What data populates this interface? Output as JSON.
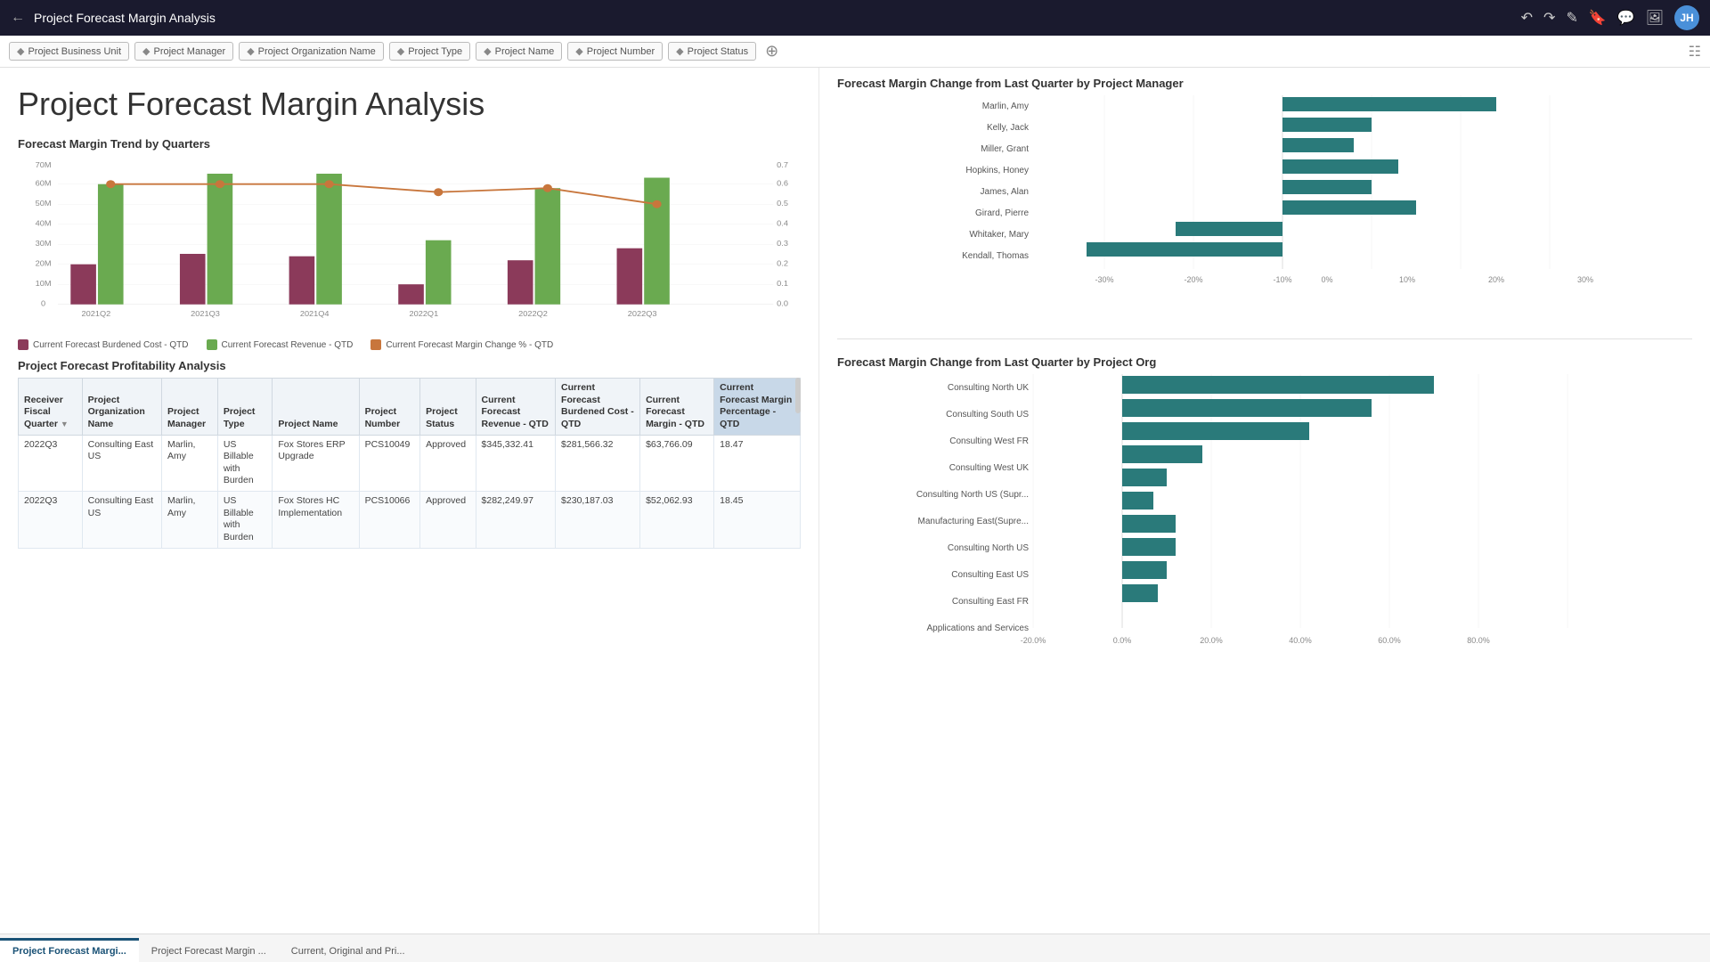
{
  "titleBar": {
    "title": "Project Forecast Margin Analysis",
    "avatar": "JH"
  },
  "filterBar": {
    "chips": [
      "Project Business Unit",
      "Project Manager",
      "Project Organization Name",
      "Project Type",
      "Project Name",
      "Project Number",
      "Project Status"
    ]
  },
  "pageTitle": "Project Forecast Margin Analysis",
  "forecastTrendChart": {
    "title": "Forecast Margin Trend by Quarters",
    "quarters": [
      "2021Q2",
      "2021Q3",
      "2021Q4",
      "2022Q1",
      "2022Q2",
      "2022Q3"
    ],
    "legend": [
      {
        "label": "Current Forecast Burdened Cost - QTD",
        "color": "#8b3a5a"
      },
      {
        "label": "Current Forecast Revenue - QTD",
        "color": "#6aaa50"
      },
      {
        "label": "Current Forecast Margin Change % - QTD",
        "color": "#c8763c"
      }
    ],
    "yAxisLeft": [
      "0",
      "10M",
      "20M",
      "30M",
      "40M",
      "50M",
      "60M",
      "70M"
    ],
    "yAxisRight": [
      "0.0",
      "0.1",
      "0.2",
      "0.3",
      "0.4",
      "0.5",
      "0.6",
      "0.7"
    ]
  },
  "profitabilityTable": {
    "title": "Project Forecast Profitability Analysis",
    "headers": [
      "Receiver Fiscal Quarter",
      "Project Organization Name",
      "Project Manager",
      "Project Type",
      "Project Name",
      "Project Number",
      "Project Status",
      "Current Forecast Revenue - QTD",
      "Current Forecast Burdened Cost - QTD",
      "Current Forecast Margin - QTD",
      "Current Forecast Margin Percentage - QTD"
    ],
    "rows": [
      {
        "quarter": "2022Q3",
        "orgName": "Consulting East US",
        "manager": "Marlin, Amy",
        "type": "US Billable with Burden",
        "projectName": "Fox Stores ERP Upgrade",
        "number": "PCS10049",
        "status": "Approved",
        "revenue": "$345,332.41",
        "cost": "$281,566.32",
        "margin": "$63,766.09",
        "marginPct": "18.47"
      },
      {
        "quarter": "2022Q3",
        "orgName": "Consulting East US",
        "manager": "Marlin, Amy",
        "type": "US Billable with Burden",
        "projectName": "Fox Stores HC Implementation",
        "number": "PCS10066",
        "status": "Approved",
        "revenue": "$282,249.97",
        "cost": "$230,187.03",
        "margin": "$52,062.93",
        "marginPct": "18.45"
      }
    ]
  },
  "forecastMarginByManager": {
    "title": "Forecast Margin Change from Last Quarter by Project Manager",
    "managers": [
      {
        "name": "Marlin, Amy",
        "value": 25
      },
      {
        "name": "Kelly, Jack",
        "value": 10
      },
      {
        "name": "Miller, Grant",
        "value": 8
      },
      {
        "name": "Hopkins, Honey",
        "value": 13
      },
      {
        "name": "James, Alan",
        "value": 10
      },
      {
        "name": "Girard, Pierre",
        "value": 15
      },
      {
        "name": "Whitaker, Mary",
        "value": -12
      },
      {
        "name": "Kendall, Thomas",
        "value": -22
      }
    ],
    "axisLabels": [
      "-30%",
      "-20%",
      "-10%",
      "0%",
      "10%",
      "20%",
      "30%"
    ]
  },
  "forecastMarginByOrg": {
    "title": "Forecast Margin Change from Last Quarter by Project Org",
    "orgs": [
      {
        "name": "Consulting North UK",
        "value": 65
      },
      {
        "name": "Consulting South US",
        "value": 52
      },
      {
        "name": "Consulting West FR",
        "value": 40
      },
      {
        "name": "Consulting West UK",
        "value": 18
      },
      {
        "name": "Consulting North US (Supr...",
        "value": 10
      },
      {
        "name": "Manufacturing East(Supre...",
        "value": 7
      },
      {
        "name": "Consulting North US",
        "value": 12
      },
      {
        "name": "Consulting East US",
        "value": 12
      },
      {
        "name": "Consulting East FR",
        "value": 10
      },
      {
        "name": "Applications and Services",
        "value": 8
      }
    ],
    "axisLabels": [
      "-20.0%",
      "0.0%",
      "20.0%",
      "40.0%",
      "60.0%",
      "80.0%"
    ]
  },
  "tabs": [
    {
      "label": "Project Forecast Margi...",
      "active": true
    },
    {
      "label": "Project Forecast Margin ...",
      "active": false
    },
    {
      "label": "Current, Original and Pri...",
      "active": false
    }
  ]
}
